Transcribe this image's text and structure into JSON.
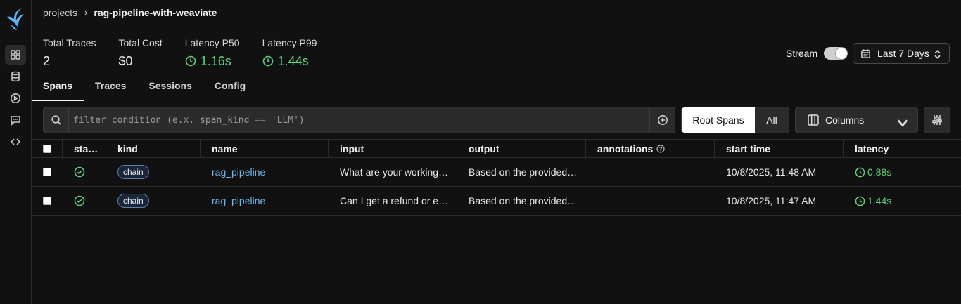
{
  "breadcrumb": {
    "root": "projects",
    "separator": "›",
    "current": "rag-pipeline-with-weaviate"
  },
  "stats": {
    "total_traces_label": "Total Traces",
    "total_traces": "2",
    "total_cost_label": "Total Cost",
    "total_cost": "$0",
    "p50_label": "Latency P50",
    "p50": "1.16s",
    "p99_label": "Latency P99",
    "p99": "1.44s"
  },
  "stream": {
    "label": "Stream",
    "enabled": true
  },
  "date_range": {
    "label": "Last 7 Days"
  },
  "tabs": [
    {
      "label": "Spans",
      "active": true
    },
    {
      "label": "Traces"
    },
    {
      "label": "Sessions"
    },
    {
      "label": "Config"
    }
  ],
  "filter": {
    "placeholder": "filter condition (e.x. span_kind == 'LLM')"
  },
  "span_toggle": {
    "root": "Root Spans",
    "all": "All",
    "selected": "Root Spans"
  },
  "columns_button": {
    "label": "Columns"
  },
  "table": {
    "headers": [
      "sta…",
      "kind",
      "name",
      "input",
      "output",
      "annotations",
      "start time",
      "latency"
    ],
    "rows": [
      {
        "kind": "chain",
        "name": "rag_pipeline",
        "input": "What are your working…",
        "output": "Based on the provided…",
        "annotations": "",
        "start_time": "10/8/2025, 11:48 AM",
        "latency": "0.88s"
      },
      {
        "kind": "chain",
        "name": "rag_pipeline",
        "input": "Can I get a refund or e…",
        "output": "Based on the provided…",
        "annotations": "",
        "start_time": "10/8/2025, 11:47 AM",
        "latency": "1.44s"
      }
    ]
  },
  "colors": {
    "accent_green": "#5fd07c",
    "link_blue": "#6fb7ec",
    "background": "#111111"
  },
  "icons": {
    "sidebar": [
      "phoenix-logo-icon",
      "grid-icon",
      "database-icon",
      "play-circle-icon",
      "chat-icon",
      "code-icon"
    ],
    "filter": [
      "search-icon",
      "plus-circle-icon"
    ]
  }
}
